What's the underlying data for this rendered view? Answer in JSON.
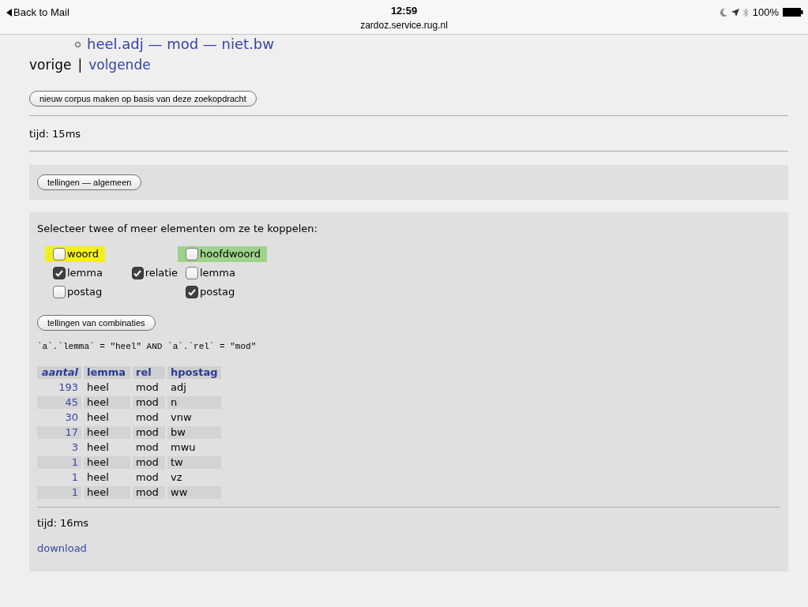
{
  "status_bar": {
    "back": "Back to Mail",
    "time": "12:59",
    "url": "zardoz.service.rug.nl",
    "battery": "100%"
  },
  "cut_list_item": "heel.adj — mod — niet.bw",
  "pager": {
    "previous": "vorige",
    "separator": "|",
    "next": "volgende"
  },
  "corpus_button": "nieuw corpus maken op basis van deze zoekopdracht",
  "time1": "tijd: 15ms",
  "general_button": "tellingen — algemeen",
  "panel": {
    "intro": "Selecteer twee of meer elementen om ze te koppelen:",
    "grid": [
      [
        {
          "kind": "highlight",
          "label": "woord",
          "checked": false,
          "color": "#f4ef1c"
        },
        {
          "kind": "blank"
        },
        {
          "kind": "highlight",
          "label": "hoofdwoord",
          "checked": false,
          "color": "#9fd38b"
        }
      ],
      [
        {
          "kind": "checkbox",
          "label": "lemma",
          "checked": true
        },
        {
          "kind": "checkbox",
          "label": "relatie",
          "checked": true
        },
        {
          "kind": "checkbox",
          "label": "lemma",
          "checked": false
        }
      ],
      [
        {
          "kind": "checkbox",
          "label": "postag",
          "checked": false
        },
        {
          "kind": "blank"
        },
        {
          "kind": "checkbox",
          "label": "postag",
          "checked": true
        }
      ]
    ],
    "combo_button": "tellingen van combinaties",
    "query": "`a`.`lemma` = \"heel\" AND `a`.`rel` = \"mod\"",
    "table": {
      "columns": [
        "aantal",
        "lemma",
        "rel",
        "hpostag"
      ],
      "rows": [
        [
          "193",
          "heel",
          "mod",
          "adj"
        ],
        [
          "45",
          "heel",
          "mod",
          "n"
        ],
        [
          "30",
          "heel",
          "mod",
          "vnw"
        ],
        [
          "17",
          "heel",
          "mod",
          "bw"
        ],
        [
          "3",
          "heel",
          "mod",
          "mwu"
        ],
        [
          "1",
          "heel",
          "mod",
          "tw"
        ],
        [
          "1",
          "heel",
          "mod",
          "vz"
        ],
        [
          "1",
          "heel",
          "mod",
          "ww"
        ]
      ]
    },
    "time2": "tijd: 16ms",
    "download": "download"
  }
}
